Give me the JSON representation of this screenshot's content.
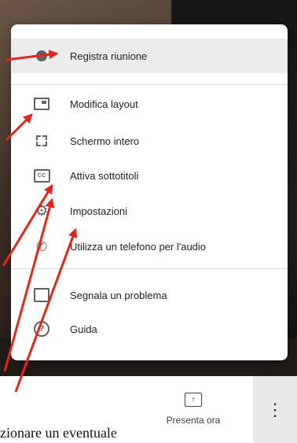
{
  "menu": {
    "items": [
      {
        "label": "Registra riunione",
        "icon": "record-icon"
      },
      {
        "label": "Modifica layout",
        "icon": "layout-icon"
      },
      {
        "label": "Schermo intero",
        "icon": "fullscreen-icon"
      },
      {
        "label": "Attiva sottotitoli",
        "icon": "closed-captions-icon"
      },
      {
        "label": "Impostazioni",
        "icon": "settings-gear-icon"
      },
      {
        "label": "Utilizza un telefono per l'audio",
        "icon": "phone-forward-icon"
      },
      {
        "label": "Segnala un problema",
        "icon": "report-icon"
      },
      {
        "label": "Guida",
        "icon": "help-icon"
      }
    ],
    "cc_glyph": "CC",
    "help_glyph": "?"
  },
  "bottom_bar": {
    "present_label": "Presenta ora",
    "present_glyph": "↑",
    "more_glyph": "⋮"
  },
  "caption_fragment": "zionare un eventuale",
  "colors": {
    "arrow": "#e1261c",
    "highlight": "#ececec",
    "icon": "#5f6368"
  }
}
